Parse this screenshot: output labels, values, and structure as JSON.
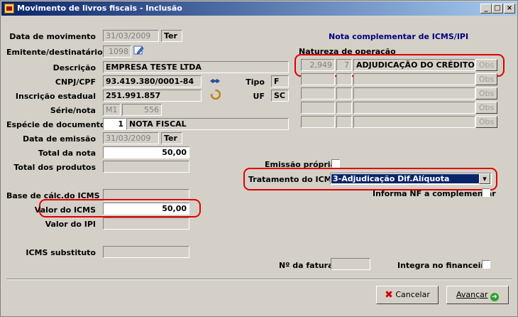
{
  "window": {
    "title": "Movimento de livros fiscais - Inclusão",
    "buttons": {
      "minimize": "_",
      "maximize": "□",
      "close": "×"
    }
  },
  "labels": {
    "data_movimento": "Data de movimento",
    "emitente": "Emitente/destinatário",
    "descricao": "Descrição",
    "cnpj": "CNPJ/CPF",
    "tipo": "Tipo",
    "inscricao": "Inscrição estadual",
    "uf": "UF",
    "serie": "Série/nota",
    "especie": "Espécie de documento",
    "data_emissao": "Data de emissão",
    "total_nota": "Total da nota",
    "total_produtos": "Total dos produtos",
    "base_icms": "Base de cálc.do ICMS",
    "valor_icms": "Valor do ICMS",
    "valor_ipi": "Valor do IPI",
    "icms_subst": "ICMS substituto",
    "nota_compl": "Nota complementar de ICMS/IPI",
    "natureza": "Natureza de operação",
    "emissao_propria": "Emissão própria",
    "tratamento": "Tratamento do ICMS",
    "informa_nf": "Informa NF a complementar",
    "num_fatura": "Nº da fatura",
    "integra": "Integra no financeiro"
  },
  "values": {
    "data_movimento": "31/03/2009",
    "data_movimento_day": "Ter",
    "emitente_code": "1098",
    "descricao": "EMPRESA TESTE LTDA",
    "cnpj": "93.419.380/0001-84",
    "tipo": "F",
    "inscricao": "251.991.857",
    "uf": "SC",
    "serie": "M1",
    "nota": "556",
    "especie_code": "1",
    "especie": "NOTA FISCAL",
    "data_emissao": "31/03/2009",
    "data_emissao_day": "Ter",
    "total_nota": "50,00",
    "valor_icms": "50,00",
    "tratamento": "3-Adjudicação Dif.Alíquota"
  },
  "natureza_rows": [
    {
      "code": "2,949",
      "seq": "7",
      "desc": "ADJUDICAÇÃO DO CRÉDITO DIF A",
      "obs": "Obs"
    },
    {
      "code": "",
      "seq": "",
      "desc": "",
      "obs": "Obs"
    },
    {
      "code": "",
      "seq": "",
      "desc": "",
      "obs": "Obs"
    },
    {
      "code": "",
      "seq": "",
      "desc": "",
      "obs": "Obs"
    },
    {
      "code": "",
      "seq": "",
      "desc": "",
      "obs": "Obs"
    }
  ],
  "footer": {
    "cancel": "Cancelar",
    "next": "Avançar"
  },
  "colors": {
    "highlight": "#e00000",
    "selected_bg": "#0a246a",
    "group_title": "#000080"
  }
}
